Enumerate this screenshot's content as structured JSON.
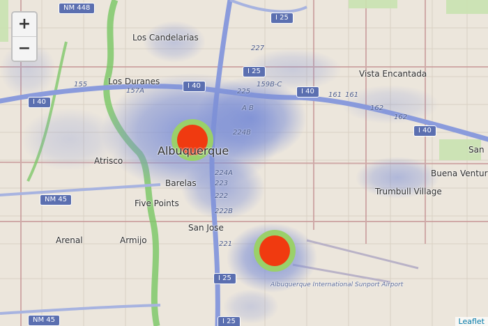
{
  "zoom": {
    "in_label": "+",
    "out_label": "−"
  },
  "attribution": "Leaflet",
  "places": {
    "los_candelarias": "Los Candelarias",
    "los_duranes": "Los Duranes",
    "vista_encantada": "Vista Encantada",
    "albuquerque": "Albuquerque",
    "atrisco": "Atrisco",
    "barelas": "Barelas",
    "five_points": "Five Points",
    "san_jose": "San Jose",
    "arenal": "Arenal",
    "armijo": "Armijo",
    "trumbull_village": "Trumbull Village",
    "buena_ventura": "Buena Ventur",
    "sand": "San",
    "airport": "Albuquerque International Sunport Airport"
  },
  "shields": {
    "nm448": "NM 448",
    "i25_top": "I 25",
    "i25_mid": "I 25",
    "i40_left": "I 40",
    "i40_center": "I 40",
    "i40_east": "I 40",
    "i40_far_east": "I 40",
    "nm45_mid": "NM 45",
    "nm45_bottom": "NM 45",
    "i25_bottom": "I 25",
    "i25_bottom2": "I 25"
  },
  "exits": {
    "e227": "227",
    "e225": "225",
    "e155": "155",
    "e157a": "157A",
    "e159bc": "159B-C",
    "e161": "161",
    "e161b": "161",
    "e162": "162",
    "e162b": "162",
    "e224b": "224B",
    "e224a": "224A",
    "e223": "223",
    "e222": "222",
    "e222b": "222B",
    "e221": "221",
    "eab": "A B"
  },
  "colors": {
    "land": "#ece6dc",
    "heat_low": "#7c8fd6",
    "heat_mid": "#8fce5a",
    "heat_high": "#f03a10",
    "interstate": "#8a9bdc",
    "river": "#7fc86a"
  },
  "heat_hotspots": [
    {
      "name": "downtown",
      "intensity": "high"
    },
    {
      "name": "airport",
      "intensity": "high"
    }
  ]
}
